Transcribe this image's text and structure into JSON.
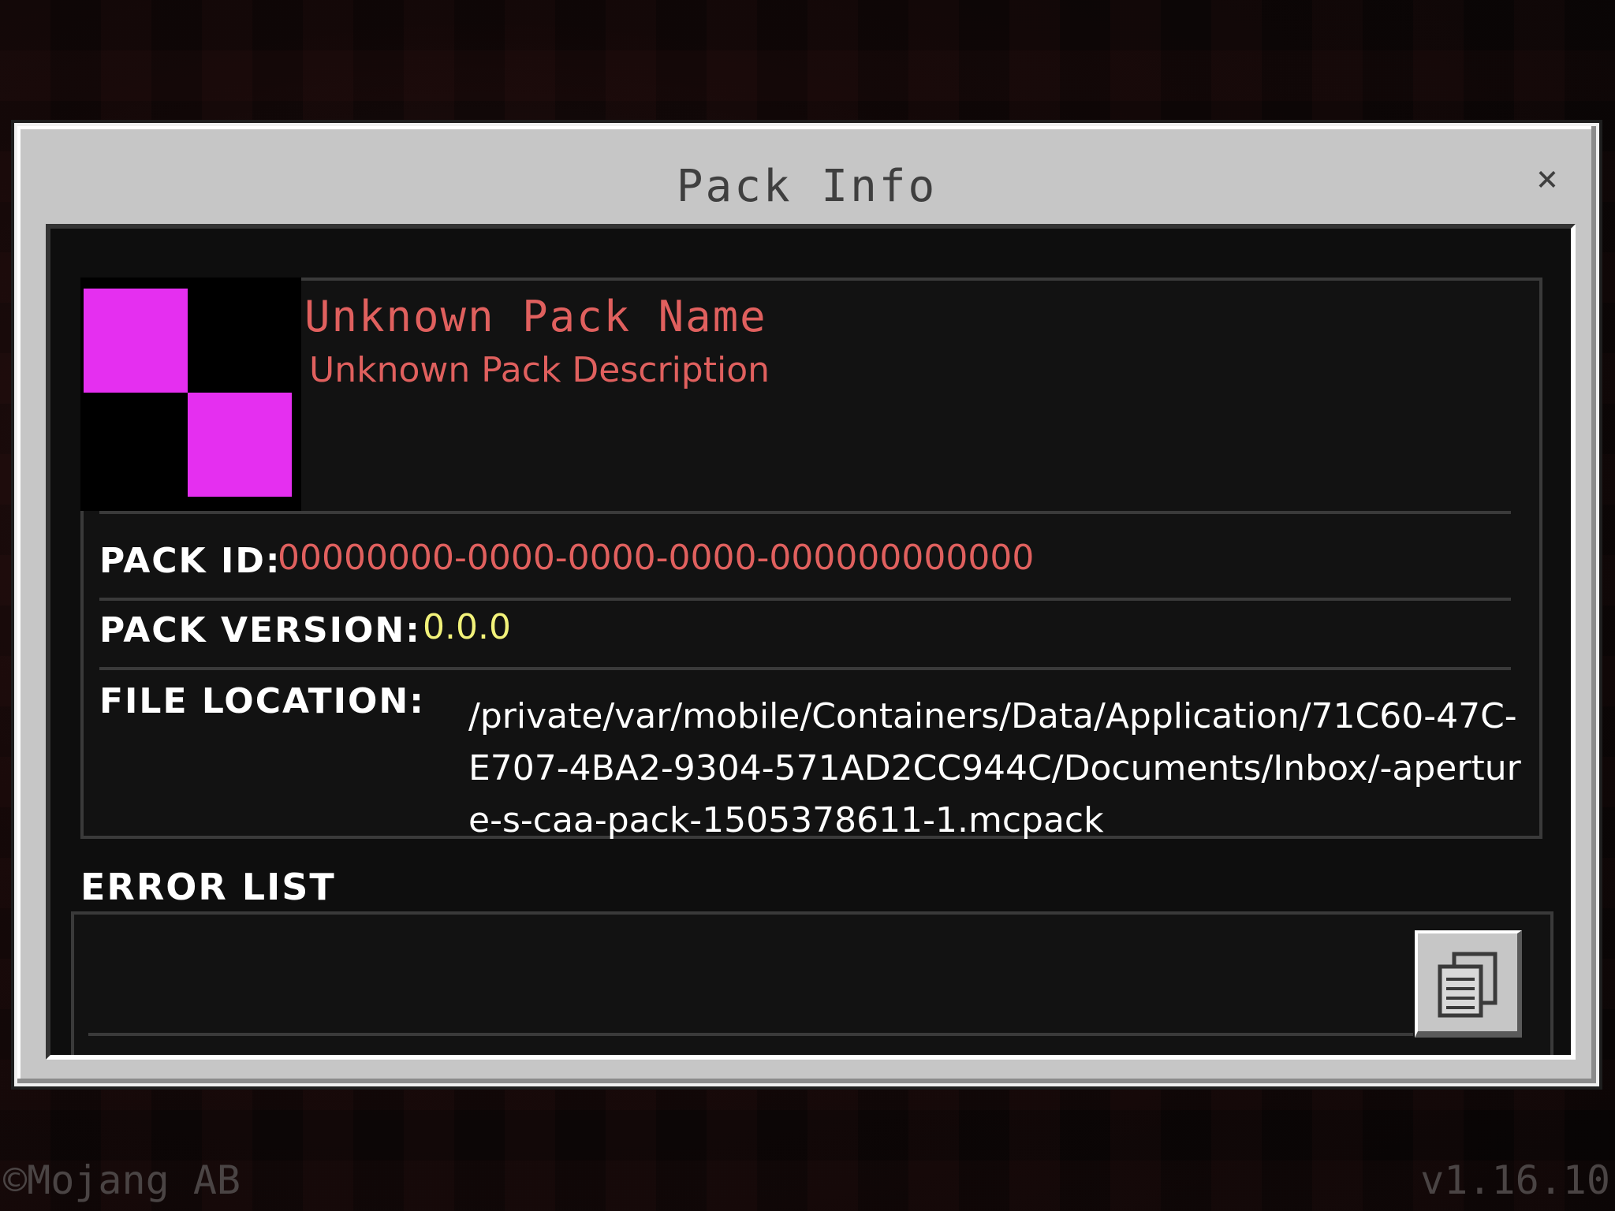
{
  "dialog": {
    "title": "Pack Info",
    "close_glyph": "×",
    "close_icon": "close-icon"
  },
  "pack": {
    "icon": "missing-texture-icon",
    "icon_color": "#e52ff0",
    "name": "Unknown Pack Name",
    "description": "Unknown Pack Description",
    "id_label": "PACK ID:",
    "id_value": "00000000-0000-0000-0000-000000000000",
    "version_label": "PACK VERSION:",
    "version_value": "0.0.0",
    "location_label": "FILE LOCATION:",
    "location_value": "/private/var/mobile/Containers/Data/Application/71C60-47C-E707-4BA2-9304-571AD2CC944C/Documents/Inbox/-aperture-s-caa-pack-1505378611-1.mcpack"
  },
  "errors": {
    "title": "ERROR LIST",
    "copy_icon": "copy-icon"
  },
  "footer": {
    "copyright": "©Mojang AB",
    "version": "v1.16.10"
  },
  "colors": {
    "name_red": "#e0605e",
    "version_yellow": "#f2f27a",
    "dialog_gray": "#c6c6c6"
  }
}
